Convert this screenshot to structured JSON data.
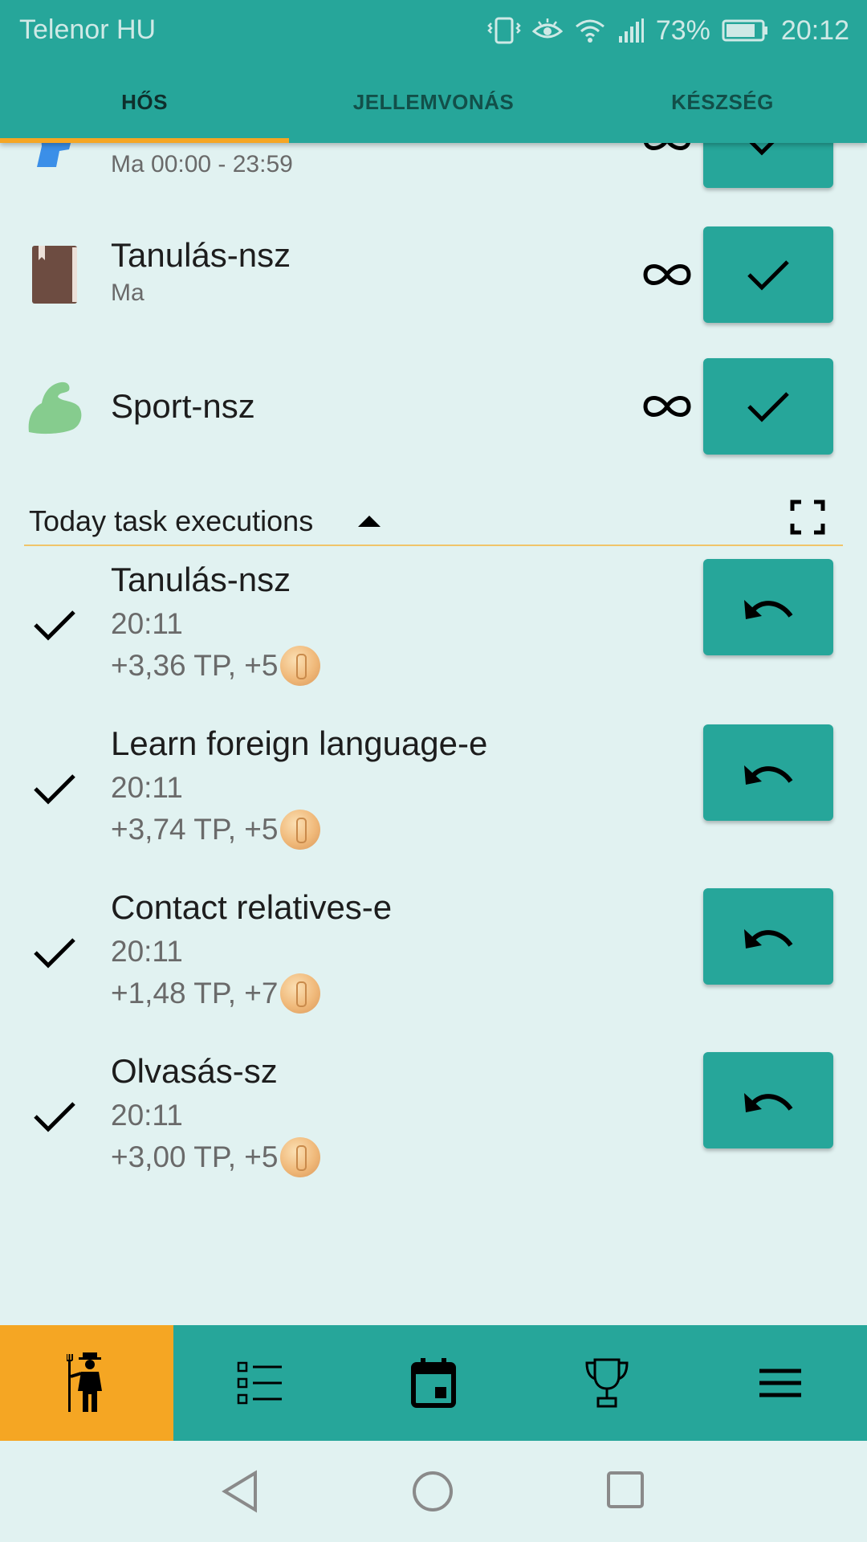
{
  "status_bar": {
    "carrier": "Telenor HU",
    "battery": "73%",
    "time": "20:12"
  },
  "tabs": [
    {
      "label": "HŐS",
      "active": true
    },
    {
      "label": "JELLEMVONÁS",
      "active": false
    },
    {
      "label": "KÉSZSÉG",
      "active": false
    }
  ],
  "habits": [
    {
      "title": "",
      "subtitle": "Ma 00:00 - 23:59",
      "icon": "water-icon",
      "repeat": "infinity-icon",
      "action": "check-icon"
    },
    {
      "title": "Tanulás-nsz",
      "subtitle": "Ma",
      "icon": "book-icon",
      "repeat": "infinity-icon",
      "action": "check-icon"
    },
    {
      "title": "Sport-nsz",
      "subtitle": "",
      "icon": "muscle-icon",
      "repeat": "infinity-icon",
      "action": "check-icon"
    }
  ],
  "executions_section": {
    "title": "Today task executions",
    "caret": "caret-up-icon",
    "expand": "fullscreen-icon"
  },
  "executions": [
    {
      "title": "Tanulás-nsz",
      "time": "20:11",
      "reward": "+3,36 TP, +5"
    },
    {
      "title": "Learn foreign language-e",
      "time": "20:11",
      "reward": "+3,74 TP, +5"
    },
    {
      "title": "Contact relatives-e",
      "time": "20:11",
      "reward": "+1,48 TP, +7"
    },
    {
      "title": "Olvasás-sz",
      "time": "20:11",
      "reward": "+3,00 TP, +5"
    }
  ],
  "bottom_nav": [
    {
      "icon": "farmer-icon",
      "active": true
    },
    {
      "icon": "checklist-icon",
      "active": false
    },
    {
      "icon": "calendar-icon",
      "active": false
    },
    {
      "icon": "trophy-icon",
      "active": false
    },
    {
      "icon": "menu-icon",
      "active": false
    }
  ],
  "system_nav": [
    "back-icon",
    "home-icon",
    "recents-icon"
  ],
  "colors": {
    "primary": "#26a69a",
    "accent": "#f5a623",
    "background": "#e1f2f1"
  }
}
